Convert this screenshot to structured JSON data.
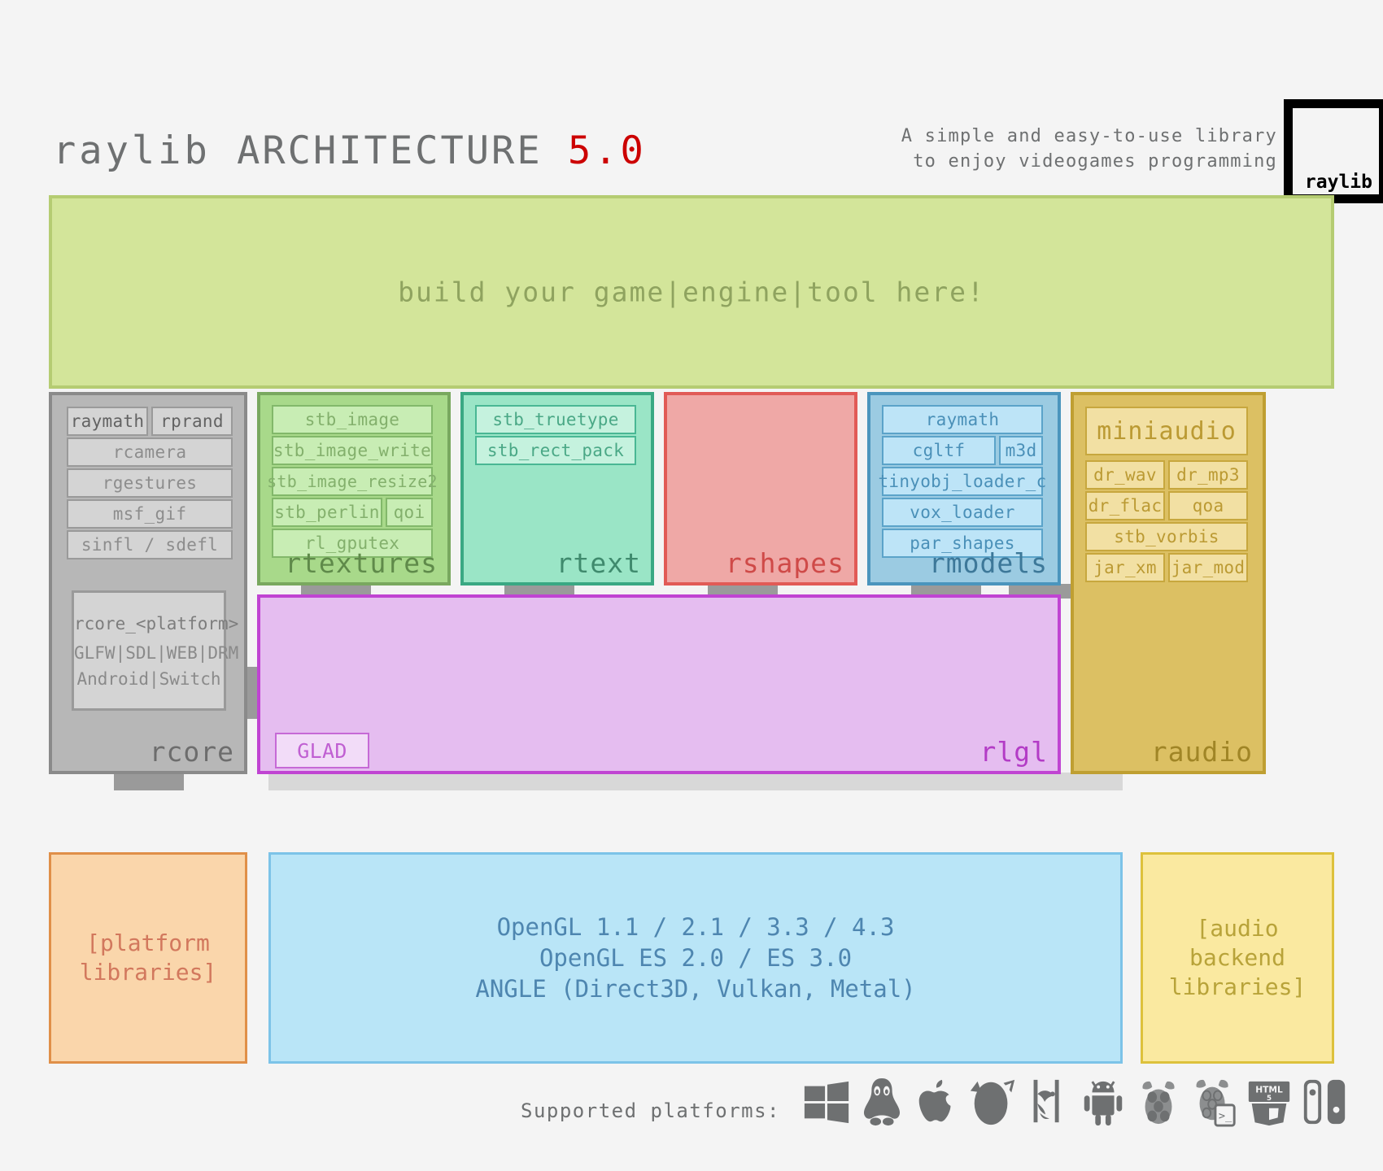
{
  "header": {
    "title_main": "raylib ",
    "title_caps": "ARCHITECTURE ",
    "title_version": "5.0",
    "tagline_line1": "A simple and easy-to-use library",
    "tagline_line2": "to enjoy videogames programming",
    "logo_text": "raylib"
  },
  "userland": {
    "text": "build your game|engine|tool here!"
  },
  "modules": {
    "rcore": {
      "label": "rcore",
      "chips": [
        "raymath",
        "rprand",
        "rcamera",
        "rgestures",
        "msf_gif",
        "sinfl / sdefl"
      ],
      "platform_title": "rcore_<platform>",
      "platform_line1": "GLFW|SDL|WEB|DRM",
      "platform_line2": "Android|Switch"
    },
    "rtextures": {
      "label": "rtextures",
      "chips": [
        "stb_image",
        "stb_image_write",
        "stb_image_resize2",
        "stb_perlin",
        "qoi",
        "rl_gputex"
      ]
    },
    "rtext": {
      "label": "rtext",
      "chips": [
        "stb_truetype",
        "stb_rect_pack"
      ]
    },
    "rshapes": {
      "label": "rshapes",
      "chips": []
    },
    "rmodels": {
      "label": "rmodels",
      "chips": [
        "raymath",
        "cgltf",
        "m3d",
        "tinyobj_loader_c",
        "vox_loader",
        "par_shapes"
      ]
    },
    "raudio": {
      "label": "raudio",
      "chips": [
        "miniaudio",
        "dr_wav",
        "dr_mp3",
        "dr_flac",
        "qoa",
        "stb_vorbis",
        "jar_xm",
        "jar_mod"
      ]
    },
    "rlgl": {
      "label": "rlgl",
      "chips": [
        "GLAD"
      ]
    }
  },
  "bottom": {
    "platform_libraries_line1": "[platform",
    "platform_libraries_line2": "libraries]",
    "opengl_line1": "OpenGL 1.1 / 2.1 / 3.3 / 4.3",
    "opengl_line2": "OpenGL ES 2.0 / ES 3.0",
    "opengl_line3": "ANGLE (Direct3D, Vulkan, Metal)",
    "audio_line1": "[audio",
    "audio_line2": "backend",
    "audio_line3": "libraries]"
  },
  "footer": {
    "label": "Supported platforms:",
    "icons": [
      "windows-icon",
      "linux-icon",
      "apple-icon",
      "freebsd-icon",
      "dragonflybsd-icon",
      "android-icon",
      "raspberrypi-icon",
      "raspberrypi-terminal-icon",
      "html5-icon",
      "nintendo-switch-icon"
    ]
  },
  "colors": {
    "accent_red": "#cc0000",
    "userland_bg": "#d3e59a",
    "rcore_bg": "#b7b7b7",
    "rtextures_bg": "#a8d98a",
    "rtext_bg": "#9ae5c6",
    "rshapes_bg": "#efa8a6",
    "rmodels_bg": "#9bcbe2",
    "raudio_bg": "#dcc063",
    "rlgl_bg": "#e5bdf0",
    "opengl_bg": "#b9e5f7",
    "platformlibs_bg": "#fad6ab",
    "audiolibs_bg": "#fae9a0"
  }
}
